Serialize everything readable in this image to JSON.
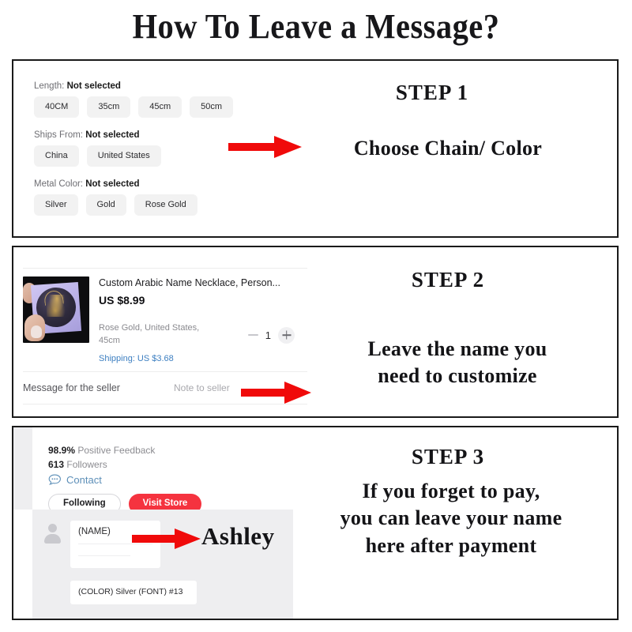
{
  "title": "How To Leave a Message?",
  "step1": {
    "heading": "STEP 1",
    "caption": "Choose Chain/ Color",
    "arrow_color": "#f00a0a",
    "options": [
      {
        "label_prefix": "Length:",
        "label_value": "Not selected",
        "choices": [
          "40CM",
          "35cm",
          "45cm",
          "50cm"
        ]
      },
      {
        "label_prefix": "Ships From:",
        "label_value": "Not selected",
        "choices": [
          "China",
          "United States"
        ]
      },
      {
        "label_prefix": "Metal Color:",
        "label_value": "Not selected",
        "choices": [
          "Silver",
          "Gold",
          "Rose Gold"
        ]
      }
    ]
  },
  "step2": {
    "heading": "STEP 2",
    "caption_line1": "Leave the name you",
    "caption_line2": "need to customize",
    "arrow_color": "#f00a0a",
    "cart": {
      "product_title": "Custom Arabic Name Necklace, Person...",
      "price": "US $8.99",
      "variant": "Rose Gold, United States, 45cm",
      "quantity": "1",
      "shipping": "Shipping: US $3.68",
      "shipping_color": "#3d7fc1",
      "message_label": "Message for the seller",
      "message_placeholder": "Note to seller"
    }
  },
  "step3": {
    "heading": "STEP 3",
    "caption_line1": "If you forget to pay,",
    "caption_line2": "you can leave your name",
    "caption_line3": "here after payment",
    "arrow_color": "#f00a0a",
    "seller": {
      "feedback_value": "98.9%",
      "feedback_label": "Positive Feedback",
      "followers_value": "613",
      "followers_label": "Followers",
      "contact_label": "Contact",
      "contact_color": "#5d8fb8",
      "following_button": "Following",
      "visit_store_button": "Visit Store",
      "visit_store_color": "#f5333f"
    },
    "chat": {
      "name_placeholder": "(NAME)",
      "meta_text": "(COLOR) Silver   (FONT) #13",
      "highlight_name": "Ashley"
    }
  }
}
